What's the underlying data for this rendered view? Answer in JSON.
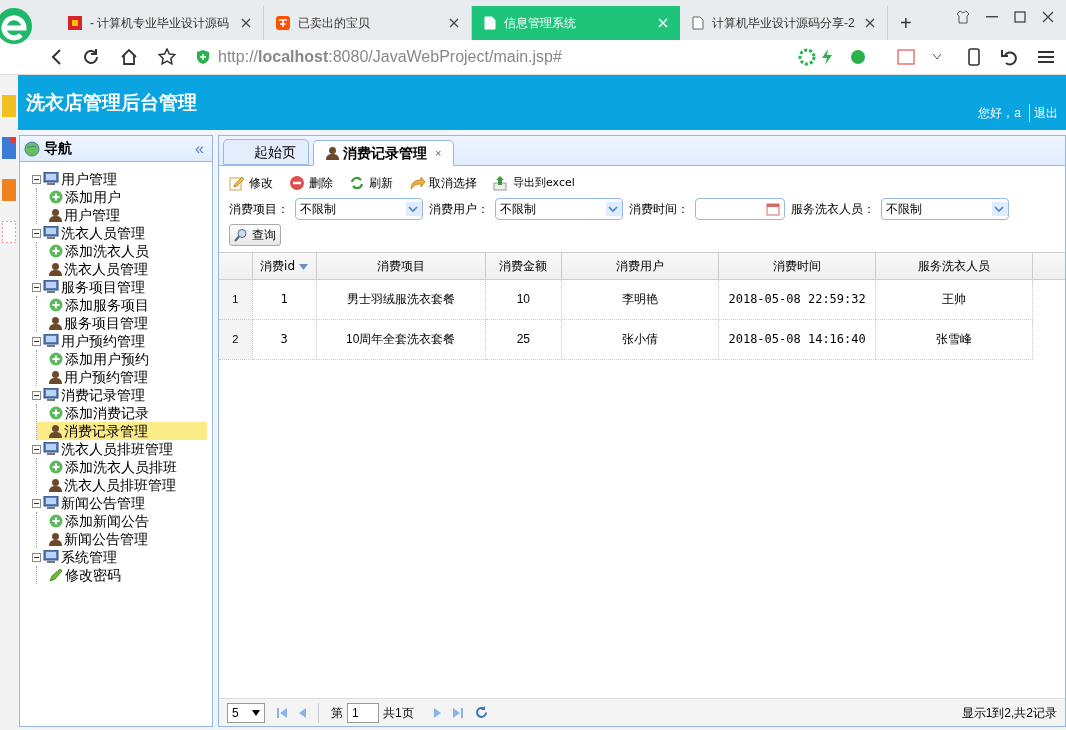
{
  "browser": {
    "tabs": [
      {
        "title": "- 计算机专业毕业设计源码",
        "kind": "site",
        "selected": false
      },
      {
        "title": "已卖出的宝贝",
        "kind": "shop",
        "selected": false
      },
      {
        "title": "信息管理系统",
        "kind": "page",
        "selected": true
      },
      {
        "title": "计算机毕业设计源码分享-2",
        "kind": "page",
        "selected": false
      }
    ],
    "new_tab": "+",
    "url": "http://**localhost**:8080/JavaWebProject/main.jsp#"
  },
  "header": {
    "title": "洗衣店管理后台管理",
    "greeting": "您好，a",
    "logout": "退出"
  },
  "nav": {
    "title": "导航",
    "collapse": "«",
    "groups": [
      {
        "label": "用户管理",
        "expanded": true,
        "children": [
          {
            "label": "添加用户",
            "kind": "add",
            "selected": false
          },
          {
            "label": "用户管理",
            "kind": "manage",
            "selected": false
          }
        ]
      },
      {
        "label": "洗衣人员管理",
        "expanded": true,
        "children": [
          {
            "label": "添加洗衣人员",
            "kind": "add",
            "selected": false
          },
          {
            "label": "洗衣人员管理",
            "kind": "manage",
            "selected": false
          }
        ]
      },
      {
        "label": "服务项目管理",
        "expanded": true,
        "children": [
          {
            "label": "添加服务项目",
            "kind": "add",
            "selected": false
          },
          {
            "label": "服务项目管理",
            "kind": "manage",
            "selected": false
          }
        ]
      },
      {
        "label": "用户预约管理",
        "expanded": true,
        "children": [
          {
            "label": "添加用户预约",
            "kind": "add",
            "selected": false
          },
          {
            "label": "用户预约管理",
            "kind": "manage",
            "selected": false
          }
        ]
      },
      {
        "label": "消费记录管理",
        "expanded": true,
        "children": [
          {
            "label": "添加消费记录",
            "kind": "add",
            "selected": false
          },
          {
            "label": "消费记录管理",
            "kind": "manage",
            "selected": true
          }
        ]
      },
      {
        "label": "洗衣人员排班管理",
        "expanded": true,
        "children": [
          {
            "label": "添加洗衣人员排班",
            "kind": "add",
            "selected": false
          },
          {
            "label": "洗衣人员排班管理",
            "kind": "manage",
            "selected": false
          }
        ]
      },
      {
        "label": "新闻公告管理",
        "expanded": true,
        "children": [
          {
            "label": "添加新闻公告",
            "kind": "add",
            "selected": false
          },
          {
            "label": "新闻公告管理",
            "kind": "manage",
            "selected": false
          }
        ]
      },
      {
        "label": "系统管理",
        "expanded": true,
        "children": [
          {
            "label": "修改密码",
            "kind": "edit",
            "selected": false
          }
        ]
      }
    ]
  },
  "tabs": [
    {
      "label": "起始页",
      "selected": false
    },
    {
      "label": "消费记录管理",
      "selected": true,
      "close": "×"
    }
  ],
  "toolbar": [
    {
      "label": "修改",
      "kind": "edit"
    },
    {
      "label": "删除",
      "kind": "delete"
    },
    {
      "label": "刷新",
      "kind": "refresh"
    },
    {
      "label": "取消选择",
      "kind": "undo"
    },
    {
      "label": "导出到excel",
      "kind": "export"
    }
  ],
  "filters": [
    {
      "label": "消费项目：",
      "kind": "select",
      "value": "不限制"
    },
    {
      "label": "消费用户：",
      "kind": "select",
      "value": "不限制"
    },
    {
      "label": "消费时间：",
      "kind": "date"
    },
    {
      "label": "服务洗衣人员：",
      "kind": "select",
      "value": "不限制"
    }
  ],
  "search_button": "查询",
  "table": {
    "columns": [
      "消费id",
      "消费项目",
      "消费金额",
      "消费用户",
      "消费时间",
      "服务洗衣人员"
    ],
    "rows": [
      {
        "number": "1",
        "cells": [
          "1",
          "男士羽绒服洗衣套餐",
          "10",
          "李明艳",
          "2018-05-08 22:59:32",
          "王帅"
        ]
      },
      {
        "number": "2",
        "cells": [
          "3",
          "10周年全套洗衣套餐",
          "25",
          "张小倩",
          "2018-05-08 14:16:40",
          "张雪峰"
        ]
      }
    ]
  },
  "pager": {
    "page_size": "5",
    "page_prefix": "第",
    "page": "1",
    "page_total": "共1页",
    "summary": "显示1到2,共2记录"
  }
}
